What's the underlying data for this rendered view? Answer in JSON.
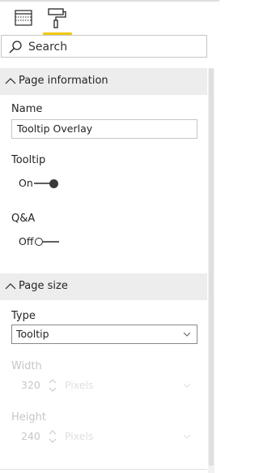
{
  "search": {
    "placeholder": "Search"
  },
  "sections": {
    "page_information": {
      "title": "Page information",
      "name_label": "Name",
      "name_value": "Tooltip Overlay",
      "tooltip_label": "Tooltip",
      "tooltip_state": "On",
      "qa_label": "Q&A",
      "qa_state": "Off"
    },
    "page_size": {
      "title": "Page size",
      "type_label": "Type",
      "type_value": "Tooltip",
      "width_label": "Width",
      "width_value": "320",
      "width_unit": "Pixels",
      "height_label": "Height",
      "height_value": "240",
      "height_unit": "Pixels"
    }
  },
  "colors": {
    "accent_underline": "#f2c811",
    "section_header_bg": "#ededed",
    "disabled_text": "#c8c6c4"
  },
  "icons": {
    "fields_tab": "table-fields-icon",
    "format_tab": "paint-roller-icon",
    "search": "search-icon",
    "collapse": "chevron-up-icon",
    "dropdown": "chevron-down-icon",
    "spinner": "spinner-arrows-icon"
  }
}
